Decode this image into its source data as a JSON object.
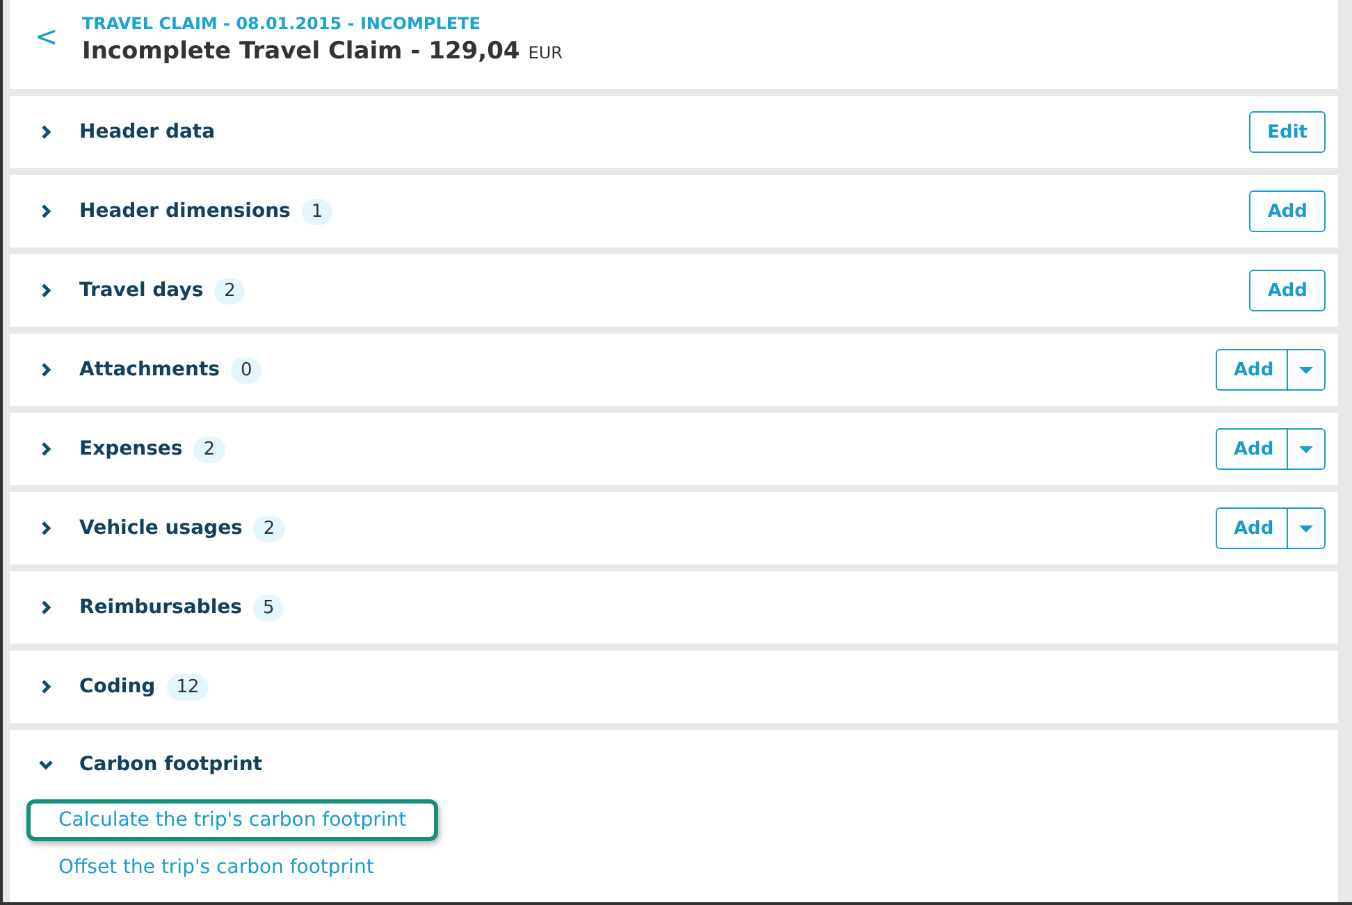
{
  "header": {
    "back": "<",
    "subtitle": "TRAVEL CLAIM - 08.01.2015 - INCOMPLETE",
    "title": "Incomplete Travel Claim - 129,04",
    "currency": "EUR"
  },
  "sections": [
    {
      "label": "Header data",
      "expanded": false,
      "action": {
        "kind": "single",
        "label": "Edit"
      }
    },
    {
      "label": "Header dimensions",
      "count": "1",
      "expanded": false,
      "action": {
        "kind": "single",
        "label": "Add"
      }
    },
    {
      "label": "Travel days",
      "count": "2",
      "expanded": false,
      "action": {
        "kind": "single",
        "label": "Add"
      }
    },
    {
      "label": "Attachments",
      "count": "0",
      "expanded": false,
      "action": {
        "kind": "split",
        "label": "Add"
      }
    },
    {
      "label": "Expenses",
      "count": "2",
      "expanded": false,
      "action": {
        "kind": "split",
        "label": "Add"
      }
    },
    {
      "label": "Vehicle usages",
      "count": "2",
      "expanded": false,
      "action": {
        "kind": "split",
        "label": "Add"
      }
    },
    {
      "label": "Reimbursables",
      "count": "5",
      "expanded": false
    },
    {
      "label": "Coding",
      "count": "12",
      "expanded": false
    },
    {
      "label": "Carbon footprint",
      "expanded": true,
      "links": [
        {
          "label": "Calculate the trip's carbon footprint",
          "highlighted": true
        },
        {
          "label": "Offset the trip's carbon footprint",
          "highlighted": false
        }
      ]
    }
  ]
}
